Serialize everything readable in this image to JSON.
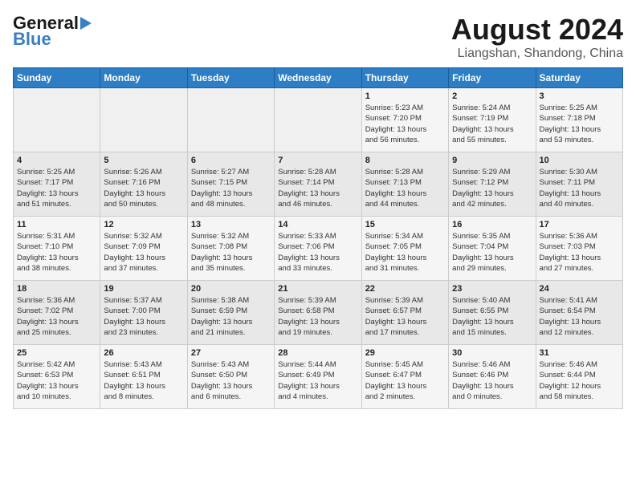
{
  "header": {
    "logo_general": "General",
    "logo_blue": "Blue",
    "month_year": "August 2024",
    "location": "Liangshan, Shandong, China"
  },
  "days_of_week": [
    "Sunday",
    "Monday",
    "Tuesday",
    "Wednesday",
    "Thursday",
    "Friday",
    "Saturday"
  ],
  "weeks": [
    {
      "days": [
        {
          "num": "",
          "content": ""
        },
        {
          "num": "",
          "content": ""
        },
        {
          "num": "",
          "content": ""
        },
        {
          "num": "",
          "content": ""
        },
        {
          "num": "1",
          "content": "Sunrise: 5:23 AM\nSunset: 7:20 PM\nDaylight: 13 hours\nand 56 minutes."
        },
        {
          "num": "2",
          "content": "Sunrise: 5:24 AM\nSunset: 7:19 PM\nDaylight: 13 hours\nand 55 minutes."
        },
        {
          "num": "3",
          "content": "Sunrise: 5:25 AM\nSunset: 7:18 PM\nDaylight: 13 hours\nand 53 minutes."
        }
      ]
    },
    {
      "days": [
        {
          "num": "4",
          "content": "Sunrise: 5:25 AM\nSunset: 7:17 PM\nDaylight: 13 hours\nand 51 minutes."
        },
        {
          "num": "5",
          "content": "Sunrise: 5:26 AM\nSunset: 7:16 PM\nDaylight: 13 hours\nand 50 minutes."
        },
        {
          "num": "6",
          "content": "Sunrise: 5:27 AM\nSunset: 7:15 PM\nDaylight: 13 hours\nand 48 minutes."
        },
        {
          "num": "7",
          "content": "Sunrise: 5:28 AM\nSunset: 7:14 PM\nDaylight: 13 hours\nand 46 minutes."
        },
        {
          "num": "8",
          "content": "Sunrise: 5:28 AM\nSunset: 7:13 PM\nDaylight: 13 hours\nand 44 minutes."
        },
        {
          "num": "9",
          "content": "Sunrise: 5:29 AM\nSunset: 7:12 PM\nDaylight: 13 hours\nand 42 minutes."
        },
        {
          "num": "10",
          "content": "Sunrise: 5:30 AM\nSunset: 7:11 PM\nDaylight: 13 hours\nand 40 minutes."
        }
      ]
    },
    {
      "days": [
        {
          "num": "11",
          "content": "Sunrise: 5:31 AM\nSunset: 7:10 PM\nDaylight: 13 hours\nand 38 minutes."
        },
        {
          "num": "12",
          "content": "Sunrise: 5:32 AM\nSunset: 7:09 PM\nDaylight: 13 hours\nand 37 minutes."
        },
        {
          "num": "13",
          "content": "Sunrise: 5:32 AM\nSunset: 7:08 PM\nDaylight: 13 hours\nand 35 minutes."
        },
        {
          "num": "14",
          "content": "Sunrise: 5:33 AM\nSunset: 7:06 PM\nDaylight: 13 hours\nand 33 minutes."
        },
        {
          "num": "15",
          "content": "Sunrise: 5:34 AM\nSunset: 7:05 PM\nDaylight: 13 hours\nand 31 minutes."
        },
        {
          "num": "16",
          "content": "Sunrise: 5:35 AM\nSunset: 7:04 PM\nDaylight: 13 hours\nand 29 minutes."
        },
        {
          "num": "17",
          "content": "Sunrise: 5:36 AM\nSunset: 7:03 PM\nDaylight: 13 hours\nand 27 minutes."
        }
      ]
    },
    {
      "days": [
        {
          "num": "18",
          "content": "Sunrise: 5:36 AM\nSunset: 7:02 PM\nDaylight: 13 hours\nand 25 minutes."
        },
        {
          "num": "19",
          "content": "Sunrise: 5:37 AM\nSunset: 7:00 PM\nDaylight: 13 hours\nand 23 minutes."
        },
        {
          "num": "20",
          "content": "Sunrise: 5:38 AM\nSunset: 6:59 PM\nDaylight: 13 hours\nand 21 minutes."
        },
        {
          "num": "21",
          "content": "Sunrise: 5:39 AM\nSunset: 6:58 PM\nDaylight: 13 hours\nand 19 minutes."
        },
        {
          "num": "22",
          "content": "Sunrise: 5:39 AM\nSunset: 6:57 PM\nDaylight: 13 hours\nand 17 minutes."
        },
        {
          "num": "23",
          "content": "Sunrise: 5:40 AM\nSunset: 6:55 PM\nDaylight: 13 hours\nand 15 minutes."
        },
        {
          "num": "24",
          "content": "Sunrise: 5:41 AM\nSunset: 6:54 PM\nDaylight: 13 hours\nand 12 minutes."
        }
      ]
    },
    {
      "days": [
        {
          "num": "25",
          "content": "Sunrise: 5:42 AM\nSunset: 6:53 PM\nDaylight: 13 hours\nand 10 minutes."
        },
        {
          "num": "26",
          "content": "Sunrise: 5:43 AM\nSunset: 6:51 PM\nDaylight: 13 hours\nand 8 minutes."
        },
        {
          "num": "27",
          "content": "Sunrise: 5:43 AM\nSunset: 6:50 PM\nDaylight: 13 hours\nand 6 minutes."
        },
        {
          "num": "28",
          "content": "Sunrise: 5:44 AM\nSunset: 6:49 PM\nDaylight: 13 hours\nand 4 minutes."
        },
        {
          "num": "29",
          "content": "Sunrise: 5:45 AM\nSunset: 6:47 PM\nDaylight: 13 hours\nand 2 minutes."
        },
        {
          "num": "30",
          "content": "Sunrise: 5:46 AM\nSunset: 6:46 PM\nDaylight: 13 hours\nand 0 minutes."
        },
        {
          "num": "31",
          "content": "Sunrise: 5:46 AM\nSunset: 6:44 PM\nDaylight: 12 hours\nand 58 minutes."
        }
      ]
    }
  ]
}
